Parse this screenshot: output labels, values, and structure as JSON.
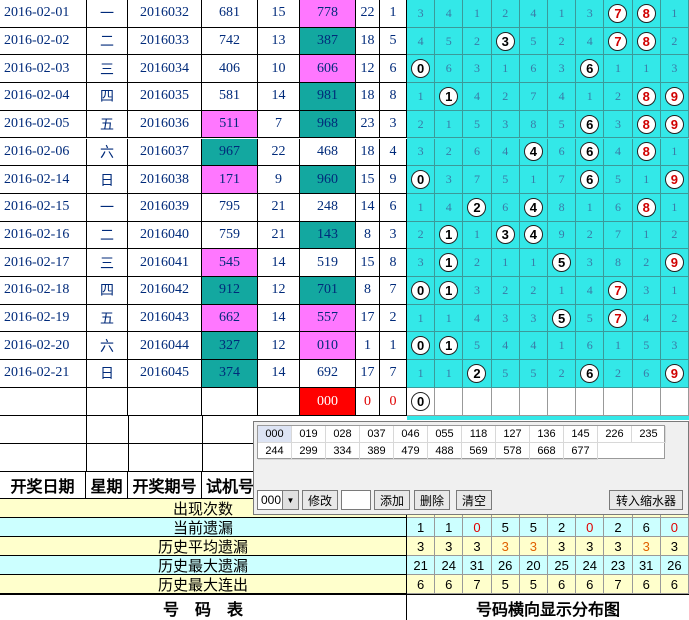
{
  "rows": [
    {
      "date": "2016-02-01",
      "weekday": "一",
      "issue": "2016032",
      "test": "681",
      "tspan": "15",
      "draw": "778",
      "sum": "22",
      "span": "1",
      "tc": "",
      "dc": "pink",
      "grid": [
        "3",
        "4",
        "1",
        "2",
        "4",
        "1",
        "3",
        "7",
        "8",
        "1"
      ],
      "balls": [
        7,
        8
      ]
    },
    {
      "date": "2016-02-02",
      "weekday": "二",
      "issue": "2016033",
      "test": "742",
      "tspan": "13",
      "draw": "387",
      "sum": "18",
      "span": "5",
      "tc": "",
      "dc": "teal",
      "grid": [
        "4",
        "5",
        "2",
        "3",
        "5",
        "2",
        "4",
        "7",
        "8",
        "2"
      ],
      "balls": [
        3,
        7,
        8
      ]
    },
    {
      "date": "2016-02-03",
      "weekday": "三",
      "issue": "2016034",
      "test": "406",
      "tspan": "10",
      "draw": "606",
      "sum": "12",
      "span": "6",
      "tc": "",
      "dc": "pink",
      "grid": [
        "0",
        "6",
        "3",
        "1",
        "6",
        "3",
        "6",
        "1",
        "1",
        "3"
      ],
      "balls": [
        0,
        6
      ]
    },
    {
      "date": "2016-02-04",
      "weekday": "四",
      "issue": "2016035",
      "test": "581",
      "tspan": "14",
      "draw": "981",
      "sum": "18",
      "span": "8",
      "tc": "",
      "dc": "teal",
      "grid": [
        "1",
        "1",
        "4",
        "2",
        "7",
        "4",
        "1",
        "2",
        "8",
        "9"
      ],
      "balls": [
        1,
        8,
        9
      ]
    },
    {
      "date": "2016-02-05",
      "weekday": "五",
      "issue": "2016036",
      "test": "511",
      "tspan": "7",
      "draw": "968",
      "sum": "23",
      "span": "3",
      "tc": "pink",
      "dc": "teal",
      "grid": [
        "2",
        "1",
        "5",
        "3",
        "8",
        "5",
        "6",
        "3",
        "8",
        "9"
      ],
      "balls": [
        6,
        8,
        9
      ]
    },
    {
      "date": "2016-02-06",
      "weekday": "六",
      "issue": "2016037",
      "test": "967",
      "tspan": "22",
      "draw": "468",
      "sum": "18",
      "span": "4",
      "tc": "teal",
      "dc": "",
      "grid": [
        "3",
        "2",
        "6",
        "4",
        "4",
        "6",
        "6",
        "4",
        "8",
        "1"
      ],
      "balls": [
        4,
        6,
        8
      ]
    },
    {
      "date": "2016-02-14",
      "weekday": "日",
      "issue": "2016038",
      "test": "171",
      "tspan": "9",
      "draw": "960",
      "sum": "15",
      "span": "9",
      "tc": "pink",
      "dc": "teal",
      "grid": [
        "0",
        "3",
        "7",
        "5",
        "1",
        "7",
        "6",
        "5",
        "1",
        "9"
      ],
      "balls": [
        0,
        6,
        9
      ]
    },
    {
      "date": "2016-02-15",
      "weekday": "一",
      "issue": "2016039",
      "test": "795",
      "tspan": "21",
      "draw": "248",
      "sum": "14",
      "span": "6",
      "tc": "",
      "dc": "",
      "grid": [
        "1",
        "4",
        "2",
        "6",
        "4",
        "8",
        "1",
        "6",
        "8",
        "1"
      ],
      "balls": [
        2,
        4,
        8
      ]
    },
    {
      "date": "2016-02-16",
      "weekday": "二",
      "issue": "2016040",
      "test": "759",
      "tspan": "21",
      "draw": "143",
      "sum": "8",
      "span": "3",
      "tc": "",
      "dc": "teal",
      "grid": [
        "2",
        "1",
        "1",
        "3",
        "4",
        "9",
        "2",
        "7",
        "1",
        "2"
      ],
      "balls": [
        1,
        3,
        4
      ]
    },
    {
      "date": "2016-02-17",
      "weekday": "三",
      "issue": "2016041",
      "test": "545",
      "tspan": "14",
      "draw": "519",
      "sum": "15",
      "span": "8",
      "tc": "pink",
      "dc": "",
      "grid": [
        "3",
        "1",
        "2",
        "1",
        "1",
        "5",
        "3",
        "8",
        "2",
        "9"
      ],
      "balls": [
        1,
        5,
        9
      ]
    },
    {
      "date": "2016-02-18",
      "weekday": "四",
      "issue": "2016042",
      "test": "912",
      "tspan": "12",
      "draw": "701",
      "sum": "8",
      "span": "7",
      "tc": "teal",
      "dc": "teal",
      "grid": [
        "0",
        "1",
        "3",
        "2",
        "2",
        "1",
        "4",
        "7",
        "3",
        "1"
      ],
      "balls": [
        0,
        1,
        7
      ]
    },
    {
      "date": "2016-02-19",
      "weekday": "五",
      "issue": "2016043",
      "test": "662",
      "tspan": "14",
      "draw": "557",
      "sum": "17",
      "span": "2",
      "tc": "pink",
      "dc": "pink",
      "grid": [
        "1",
        "1",
        "4",
        "3",
        "3",
        "5",
        "5",
        "7",
        "4",
        "2"
      ],
      "balls": [
        5,
        7
      ]
    },
    {
      "date": "2016-02-20",
      "weekday": "六",
      "issue": "2016044",
      "test": "327",
      "tspan": "12",
      "draw": "010",
      "sum": "1",
      "span": "1",
      "tc": "teal",
      "dc": "pink",
      "grid": [
        "0",
        "1",
        "5",
        "4",
        "4",
        "1",
        "6",
        "1",
        "5",
        "3"
      ],
      "balls": [
        0,
        1
      ]
    },
    {
      "date": "2016-02-21",
      "weekday": "日",
      "issue": "2016045",
      "test": "374",
      "tspan": "14",
      "draw": "692",
      "sum": "17",
      "span": "7",
      "tc": "teal",
      "dc": "",
      "grid": [
        "1",
        "1",
        "2",
        "5",
        "5",
        "2",
        "6",
        "2",
        "6",
        "9"
      ],
      "balls": [
        2,
        6,
        9
      ]
    }
  ],
  "pending": {
    "draw": "000",
    "sum": "0",
    "span": "0",
    "ball": "0"
  },
  "header": {
    "date": "开奖日期",
    "weekday": "星期",
    "issue": "开奖期号",
    "test": "试机号"
  },
  "panel": {
    "nums": [
      "000",
      "019",
      "028",
      "037",
      "046",
      "055",
      "118",
      "127",
      "136",
      "145",
      "226",
      "235",
      "244",
      "299",
      "334",
      "389",
      "479",
      "488",
      "569",
      "578",
      "668",
      "677"
    ],
    "select_value": "000",
    "btn_modify": "修改",
    "btn_add": "添加",
    "btn_delete": "删除",
    "btn_clear": "清空",
    "btn_transfer": "转入缩水器"
  },
  "stats": [
    {
      "label": "出现次数",
      "values": [
        "",
        "",
        "",
        "",
        "",
        "",
        "",
        "",
        "",
        ""
      ],
      "bg": "#ffffcc"
    },
    {
      "label": "当前遗漏",
      "values": [
        "1",
        "1",
        "0",
        "5",
        "5",
        "2",
        "0",
        "2",
        "6",
        "0"
      ],
      "bg": "#ccffff"
    },
    {
      "label": "历史平均遗漏",
      "values": [
        "3",
        "3",
        "3",
        "3",
        "3",
        "3",
        "3",
        "3",
        "3",
        "3"
      ],
      "bg": "#ffffcc"
    },
    {
      "label": "历史最大遗漏",
      "values": [
        "21",
        "24",
        "31",
        "26",
        "20",
        "25",
        "24",
        "23",
        "31",
        "26"
      ],
      "bg": "#ccffff"
    },
    {
      "label": "历史最大连出",
      "values": [
        "6",
        "6",
        "7",
        "5",
        "5",
        "6",
        "6",
        "7",
        "6",
        "6"
      ],
      "bg": "#ffffcc"
    }
  ],
  "footer": {
    "left": "号　码　表",
    "right": "号码横向显示分布图"
  }
}
